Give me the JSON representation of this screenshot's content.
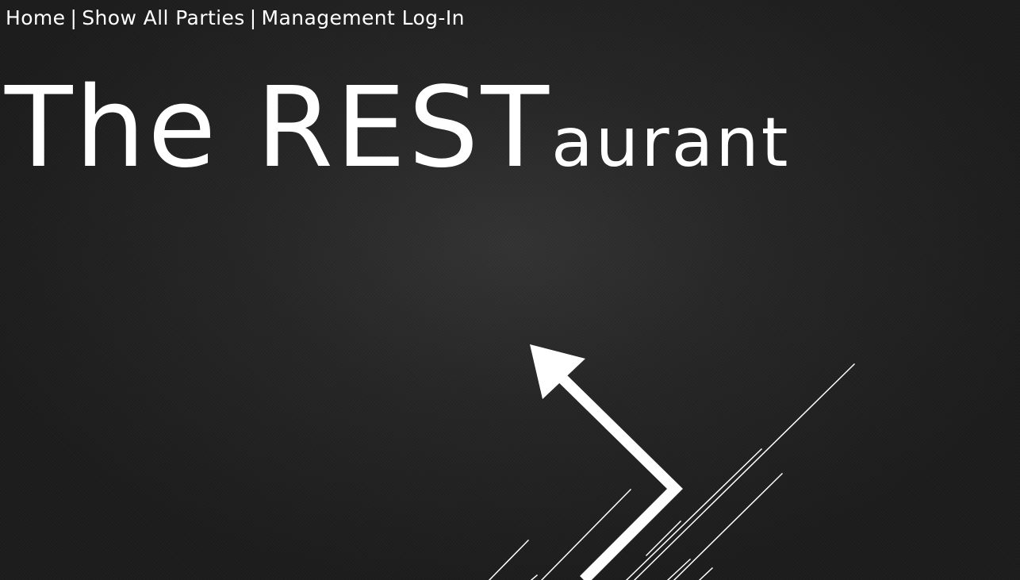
{
  "nav": {
    "items": [
      {
        "label": "Home"
      },
      {
        "label": "Show All Parties"
      },
      {
        "label": "Management Log-In"
      }
    ],
    "separator": "|"
  },
  "header": {
    "title_big": "The REST",
    "title_small": "aurant"
  },
  "theme": {
    "background": "#222222",
    "text": "#ffffff"
  }
}
